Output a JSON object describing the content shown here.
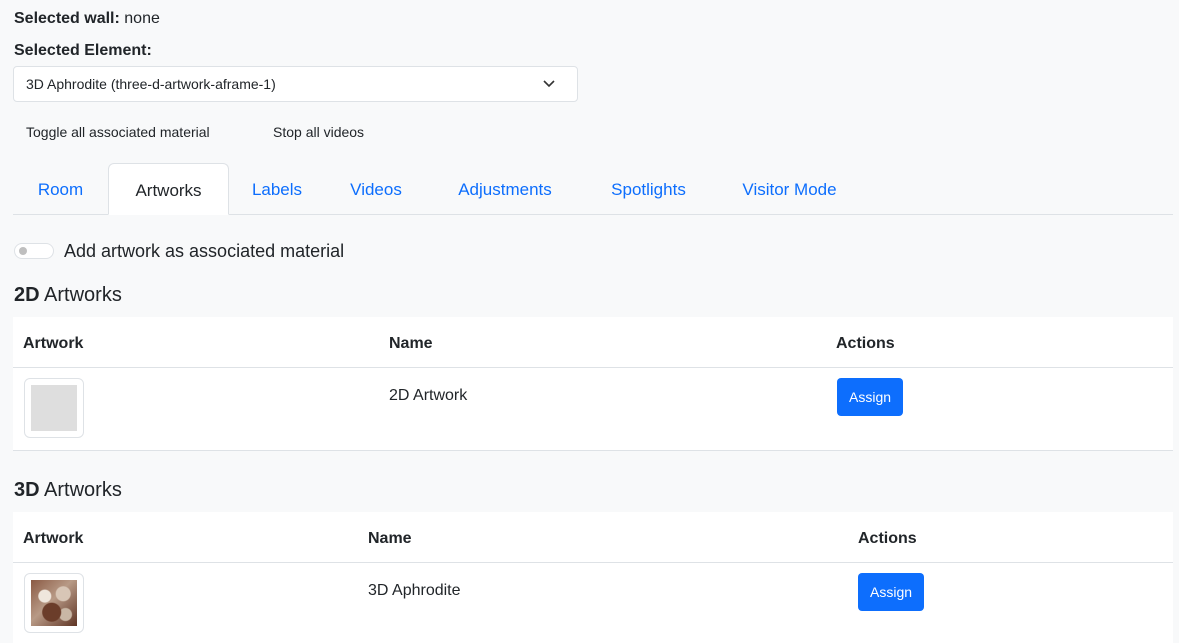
{
  "selected_wall": {
    "label": "Selected wall:",
    "value": "none"
  },
  "selected_element": {
    "label": "Selected Element:",
    "value": "3D Aphrodite (three-d-artwork-aframe-1)"
  },
  "actions": {
    "toggle_label": "Toggle all associated material",
    "stop_label": "Stop all videos"
  },
  "tabs": [
    {
      "label": "Room",
      "active": false
    },
    {
      "label": "Artworks",
      "active": true
    },
    {
      "label": "Labels",
      "active": false
    },
    {
      "label": "Videos",
      "active": false
    },
    {
      "label": "Adjustments",
      "active": false
    },
    {
      "label": "Spotlights",
      "active": false
    },
    {
      "label": "Visitor Mode",
      "active": false
    }
  ],
  "switch": {
    "label": "Add artwork as associated material",
    "checked": false
  },
  "section_2d": {
    "bold": "2D",
    "rest": " Artworks"
  },
  "section_3d": {
    "bold": "3D",
    "rest": " Artworks"
  },
  "table_headers": {
    "artwork": "Artwork",
    "name": "Name",
    "actions": "Actions"
  },
  "rows_2d": [
    {
      "name": "2D Artwork",
      "action": "Assign"
    }
  ],
  "rows_3d": [
    {
      "name": "3D Aphrodite",
      "action": "Assign"
    }
  ],
  "colors": {
    "primary": "#0d6efd",
    "border": "#dee2e6",
    "background": "#f8f9fa"
  },
  "icons": {
    "select": "chevron-down-icon",
    "switch": "toggle-switch-icon"
  }
}
